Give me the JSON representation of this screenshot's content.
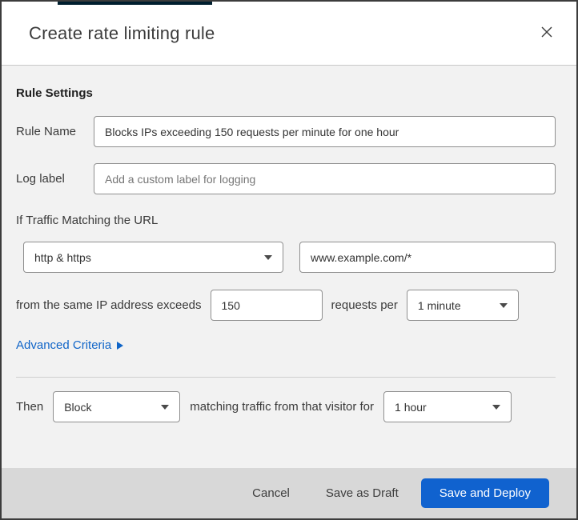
{
  "modal": {
    "title": "Create rate limiting rule"
  },
  "colors": {
    "top_strip": "#001f2f",
    "link_blue": "#1065c8",
    "primary_button_blue": "#1062cf",
    "body_background": "#f2f2f2",
    "footer_background": "#d8d8d8"
  },
  "rule_settings": {
    "heading": "Rule Settings",
    "rule_name": {
      "label": "Rule Name",
      "value": "Blocks IPs exceeding 150 requests per minute for one hour"
    },
    "log_label": {
      "label": "Log label",
      "placeholder": "Add a custom label for logging"
    },
    "match": {
      "intro": "If Traffic Matching the URL",
      "scheme_selected": "http & https",
      "url_value": "www.example.com/*",
      "threshold_prefix": "from the same IP address exceeds",
      "threshold_value": "150",
      "threshold_suffix": "requests per",
      "period_selected": "1 minute",
      "advanced_link": "Advanced Criteria"
    },
    "action": {
      "prefix": "Then",
      "action_selected": "Block",
      "middle": "matching traffic from that visitor for",
      "duration_selected": "1 hour"
    }
  },
  "footer": {
    "cancel_label": "Cancel",
    "save_draft_label": "Save as Draft",
    "save_deploy_label": "Save and Deploy"
  }
}
